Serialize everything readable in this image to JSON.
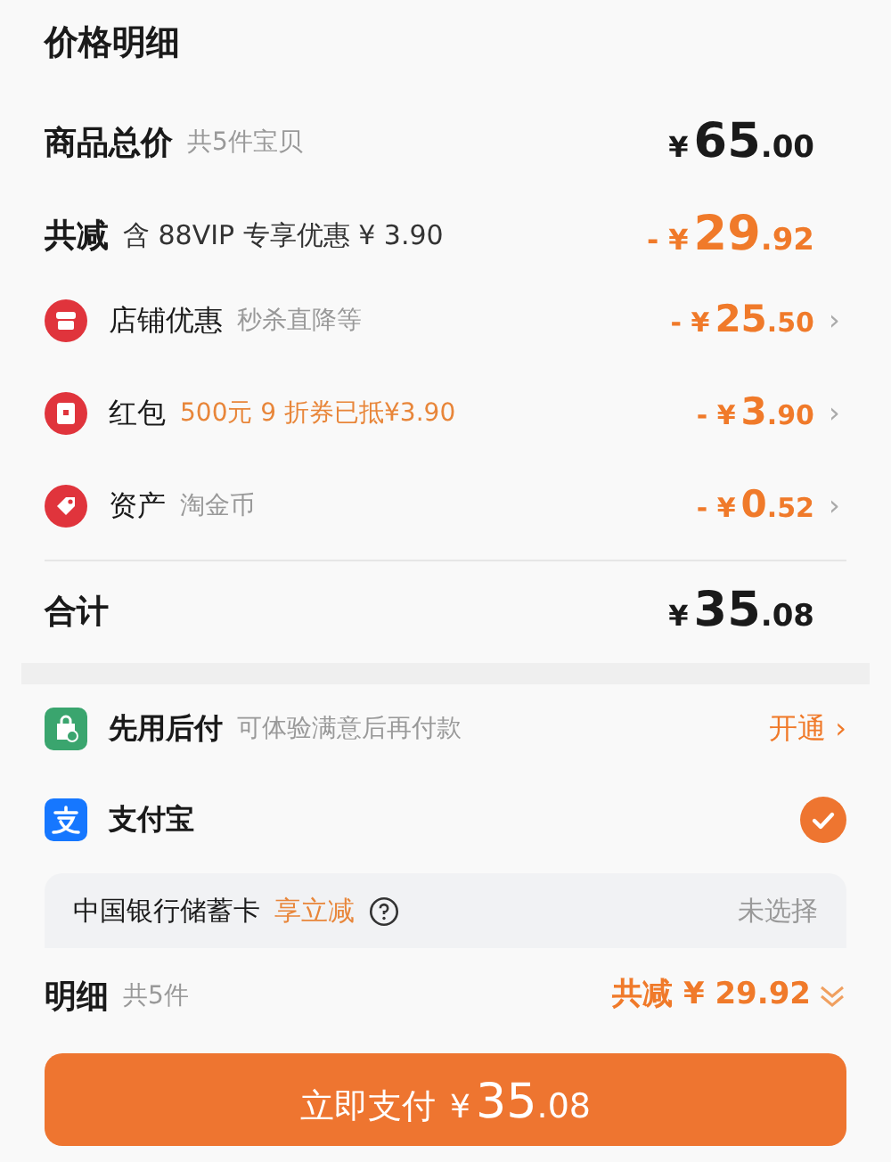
{
  "title": "价格明细",
  "goods_total": {
    "label": "商品总价",
    "note": "共5件宝贝",
    "price": {
      "sign": "¥",
      "integer": "65",
      "decimal": ".00"
    }
  },
  "total_reduction": {
    "label": "共减",
    "note": "含 88VIP 专享优惠 ¥ 3.90",
    "price": {
      "sign": "- ¥",
      "integer": "29",
      "decimal": ".92"
    }
  },
  "discounts": [
    {
      "kind": "shop",
      "label": "店铺优惠",
      "note": "秒杀直降等",
      "note_accent": false,
      "price": {
        "sign": "- ¥",
        "integer": "25",
        "decimal": ".50"
      },
      "chevron": "›"
    },
    {
      "kind": "red_packet",
      "label": "红包",
      "note": "500元 9 折券已抵¥3.90",
      "note_accent": true,
      "price": {
        "sign": "- ¥",
        "integer": "3",
        "decimal": ".90"
      },
      "chevron": "›"
    },
    {
      "kind": "asset",
      "label": "资产",
      "note": "淘金币",
      "note_accent": false,
      "price": {
        "sign": "- ¥",
        "integer": "0",
        "decimal": ".52"
      },
      "chevron": "›"
    }
  ],
  "total": {
    "label": "合计",
    "price": {
      "sign": "¥",
      "integer": "35",
      "decimal": ".08"
    }
  },
  "payments": [
    {
      "kind": "pay_later",
      "label": "先用后付",
      "note": "可体验满意后再付款",
      "action": "开通 ›",
      "selected": false
    },
    {
      "kind": "alipay",
      "label": "支付宝",
      "selected": true
    }
  ],
  "bank_card": {
    "name": "中国银行储蓄卡",
    "promo": "享立减",
    "status": "未选择"
  },
  "summary": {
    "label": "明细",
    "count": "共5件",
    "reduction": "共减 ¥ 29.92",
    "expanded": false
  },
  "pay_button": {
    "label": "立即支付",
    "price": {
      "sign": "¥",
      "integer": "35",
      "decimal": ".08"
    }
  }
}
